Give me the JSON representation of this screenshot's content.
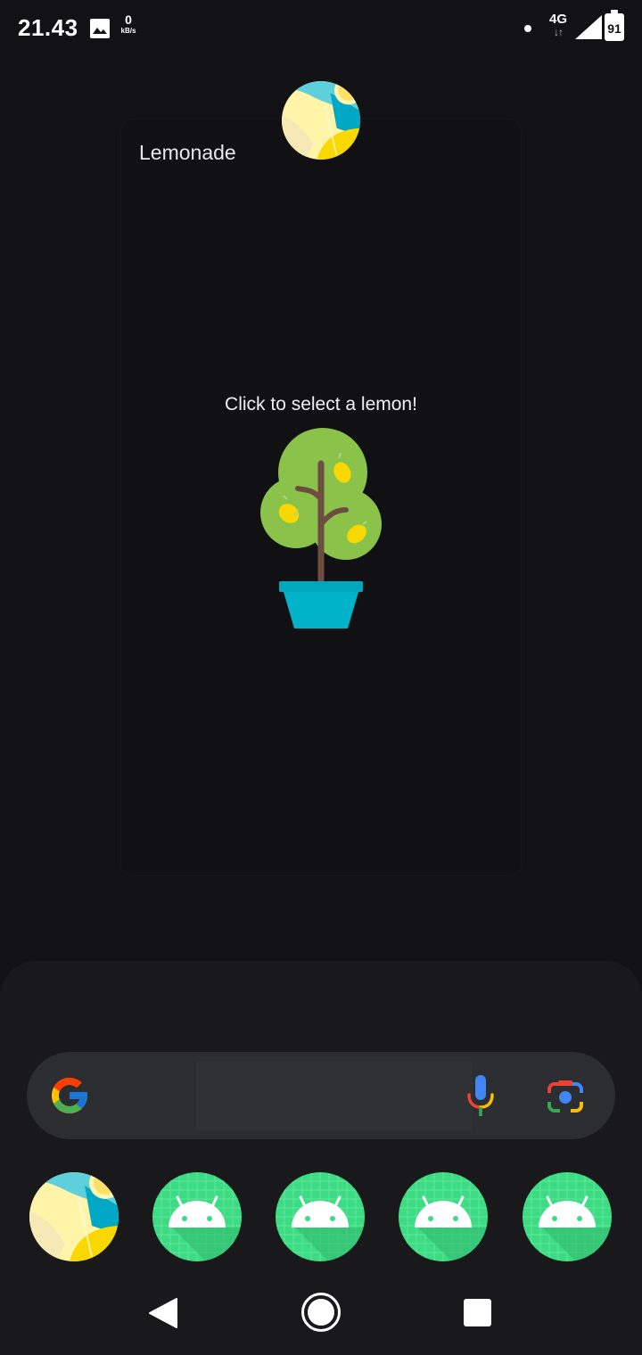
{
  "status_bar": {
    "time": "21.43",
    "net_speed_value": "0",
    "net_speed_unit": "kB/s",
    "network_type": "4G",
    "battery_level": "91",
    "icons": [
      "gallery-notification-icon",
      "dot-icon",
      "signal-icon",
      "battery-icon"
    ]
  },
  "widget": {
    "app_name": "Lemonade",
    "prompt": "Click to select a lemon!",
    "image": "lemon-tree"
  },
  "search": {
    "icons": [
      "google-g-icon",
      "microphone-icon",
      "google-lens-icon"
    ]
  },
  "dock": {
    "apps": [
      "lemonade-app-icon",
      "android-app-icon",
      "android-app-icon",
      "android-app-icon",
      "android-app-icon"
    ]
  },
  "nav": {
    "buttons": [
      "back-button",
      "home-button",
      "recents-button"
    ]
  },
  "colors": {
    "background": "#121214",
    "panel": "#19191b",
    "search_bar": "#2b2d30",
    "tree_green": "#8bc34a",
    "pot_blue": "#00b3c8",
    "android_green": "#3ddc84"
  }
}
